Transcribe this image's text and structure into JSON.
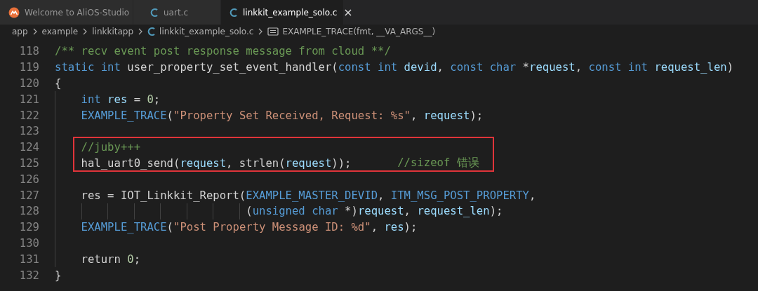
{
  "tabs": [
    {
      "label": "Welcome to AliOS-Studio",
      "kind": "app",
      "selected": false
    },
    {
      "label": "uart.c",
      "kind": "c_file",
      "selected": false
    },
    {
      "label": "linkkit_example_solo.c",
      "kind": "c_file",
      "selected": true,
      "close": "×"
    }
  ],
  "breadcrumb": [
    {
      "label": "app",
      "kind": "folder"
    },
    {
      "label": "example",
      "kind": "folder"
    },
    {
      "label": "linkkitapp",
      "kind": "folder"
    },
    {
      "label": "linkkit_example_solo.c",
      "kind": "c_file"
    },
    {
      "label": "EXAMPLE_TRACE(fmt, __VA_ARGS__)",
      "kind": "symbol"
    }
  ],
  "code_lines": [
    {
      "number": "118",
      "boxed": false,
      "tokens": [
        {
          "kind": "comment",
          "text": "/** recv event post response message from cloud **/"
        }
      ]
    },
    {
      "number": "119",
      "boxed": false,
      "tokens": [
        {
          "kind": "keyword",
          "text": "static int"
        },
        {
          "kind": "plain",
          "text": " user_property_set_event_handler("
        },
        {
          "kind": "keyword",
          "text": "const int"
        },
        {
          "kind": "variable",
          "text": " devid"
        },
        {
          "kind": "plain",
          "text": ", "
        },
        {
          "kind": "keyword",
          "text": "const char"
        },
        {
          "kind": "plain",
          "text": " *"
        },
        {
          "kind": "variable",
          "text": "request"
        },
        {
          "kind": "plain",
          "text": ", "
        },
        {
          "kind": "keyword",
          "text": "const int"
        },
        {
          "kind": "variable",
          "text": " request_len"
        },
        {
          "kind": "plain",
          "text": ")"
        }
      ]
    },
    {
      "number": "120",
      "boxed": false,
      "tokens": [
        {
          "kind": "plain",
          "text": "{"
        }
      ]
    },
    {
      "number": "121",
      "boxed": false,
      "tokens": [
        {
          "kind": "keyword",
          "text": "    int"
        },
        {
          "kind": "variable",
          "text": " res"
        },
        {
          "kind": "plain",
          "text": " = "
        },
        {
          "kind": "number",
          "text": "0"
        },
        {
          "kind": "plain",
          "text": ";"
        }
      ]
    },
    {
      "number": "122",
      "boxed": false,
      "tokens": [
        {
          "kind": "macro",
          "text": "    EXAMPLE_TRACE"
        },
        {
          "kind": "plain",
          "text": "("
        },
        {
          "kind": "string",
          "text": "\"Property Set Received, Request: %s\""
        },
        {
          "kind": "plain",
          "text": ", "
        },
        {
          "kind": "variable",
          "text": "request"
        },
        {
          "kind": "plain",
          "text": ");"
        }
      ]
    },
    {
      "number": "123",
      "boxed": false
    },
    {
      "number": "124",
      "boxed": true,
      "tokens": [
        {
          "kind": "comment",
          "text": "    //juby+++"
        }
      ]
    },
    {
      "number": "125",
      "boxed": true,
      "tokens": [
        {
          "kind": "plain",
          "text": "    hal_uart0_send("
        },
        {
          "kind": "variable",
          "text": "request"
        },
        {
          "kind": "plain",
          "text": ", strlen("
        },
        {
          "kind": "variable",
          "text": "request"
        },
        {
          "kind": "plain",
          "text": "));       "
        },
        {
          "kind": "comment",
          "text": "//sizeof 错误"
        }
      ]
    },
    {
      "number": "126",
      "boxed": false
    },
    {
      "number": "127",
      "boxed": false,
      "tokens": [
        {
          "kind": "plain",
          "text": "    res = IOT_Linkkit_Report("
        },
        {
          "kind": "macro",
          "text": "EXAMPLE_MASTER_DEVID"
        },
        {
          "kind": "plain",
          "text": ", "
        },
        {
          "kind": "macro",
          "text": "ITM_MSG_POST_PROPERTY"
        },
        {
          "kind": "plain",
          "text": ","
        }
      ]
    },
    {
      "number": "128",
      "boxed": false,
      "tokens": [
        {
          "kind": "plain",
          "text": "                             ("
        },
        {
          "kind": "keyword",
          "text": "unsigned char"
        },
        {
          "kind": "plain",
          "text": " *)"
        },
        {
          "kind": "variable",
          "text": "request"
        },
        {
          "kind": "plain",
          "text": ", "
        },
        {
          "kind": "variable",
          "text": "request_len"
        },
        {
          "kind": "plain",
          "text": ");"
        }
      ]
    },
    {
      "number": "129",
      "boxed": false,
      "tokens": [
        {
          "kind": "macro",
          "text": "    EXAMPLE_TRACE"
        },
        {
          "kind": "plain",
          "text": "("
        },
        {
          "kind": "string",
          "text": "\"Post Property Message ID: %d\""
        },
        {
          "kind": "plain",
          "text": ", "
        },
        {
          "kind": "variable",
          "text": "res"
        },
        {
          "kind": "plain",
          "text": ");"
        }
      ]
    },
    {
      "number": "130",
      "boxed": false
    },
    {
      "number": "131",
      "boxed": false,
      "tokens": [
        {
          "kind": "plain",
          "text": "    return "
        },
        {
          "kind": "number",
          "text": "0"
        },
        {
          "kind": "plain",
          "text": ";"
        }
      ]
    },
    {
      "number": "132",
      "boxed": false,
      "tokens": [
        {
          "kind": "plain",
          "text": "}"
        }
      ]
    }
  ]
}
